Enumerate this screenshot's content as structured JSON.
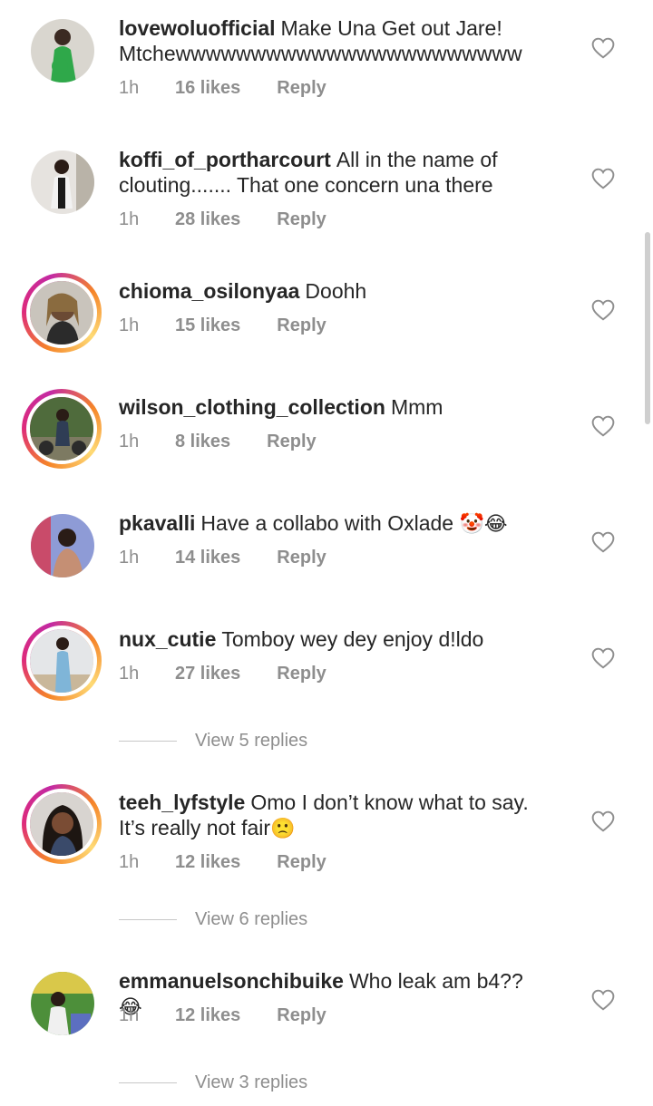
{
  "comments": [
    {
      "user": "lovewoluofficial",
      "text": "Make Una Get out Jare! Mtchewwwwwwwwwwwwwwwwwwwwwww",
      "time": "1h",
      "likes": "16 likes",
      "reply": "Reply"
    },
    {
      "user": "koffi_of_portharcourt",
      "text": "All in the name of clouting....... That one concern una there",
      "time": "1h",
      "likes": "28 likes",
      "reply": "Reply"
    },
    {
      "user": "chioma_osilonyaa",
      "text": "Doohh",
      "time": "1h",
      "likes": "15 likes",
      "reply": "Reply"
    },
    {
      "user": "wilson_clothing_collection",
      "text": "Mmm",
      "time": "1h",
      "likes": "8 likes",
      "reply": "Reply"
    },
    {
      "user": "pkavalli",
      "text": "Have a collabo with Oxlade",
      "emoji": "🤡😂",
      "time": "1h",
      "likes": "14 likes",
      "reply": "Reply"
    },
    {
      "user": "nux_cutie",
      "text": "Tomboy wey dey enjoy d!ldo",
      "time": "1h",
      "likes": "27 likes",
      "reply": "Reply",
      "view_replies": "View 5 replies"
    },
    {
      "user": "teeh_lyfstyle",
      "text": "Omo I don’t know what to say. It’s really not fair",
      "emoji": "🙁",
      "time": "1h",
      "likes": "12 likes",
      "reply": "Reply",
      "view_replies": "View 6 replies"
    },
    {
      "user": "emmanuelsonchibuike",
      "text": "Who leak am b4??",
      "emoji": "😂",
      "time": "1h",
      "likes": "12 likes",
      "reply": "Reply",
      "view_replies": "View 3 replies"
    }
  ],
  "icons": {
    "like": "heart-outline-icon"
  },
  "colors": {
    "text": "#262626",
    "meta": "#8e8e8e",
    "ring_start": "#f58529",
    "ring_end": "#dd2a7b"
  }
}
